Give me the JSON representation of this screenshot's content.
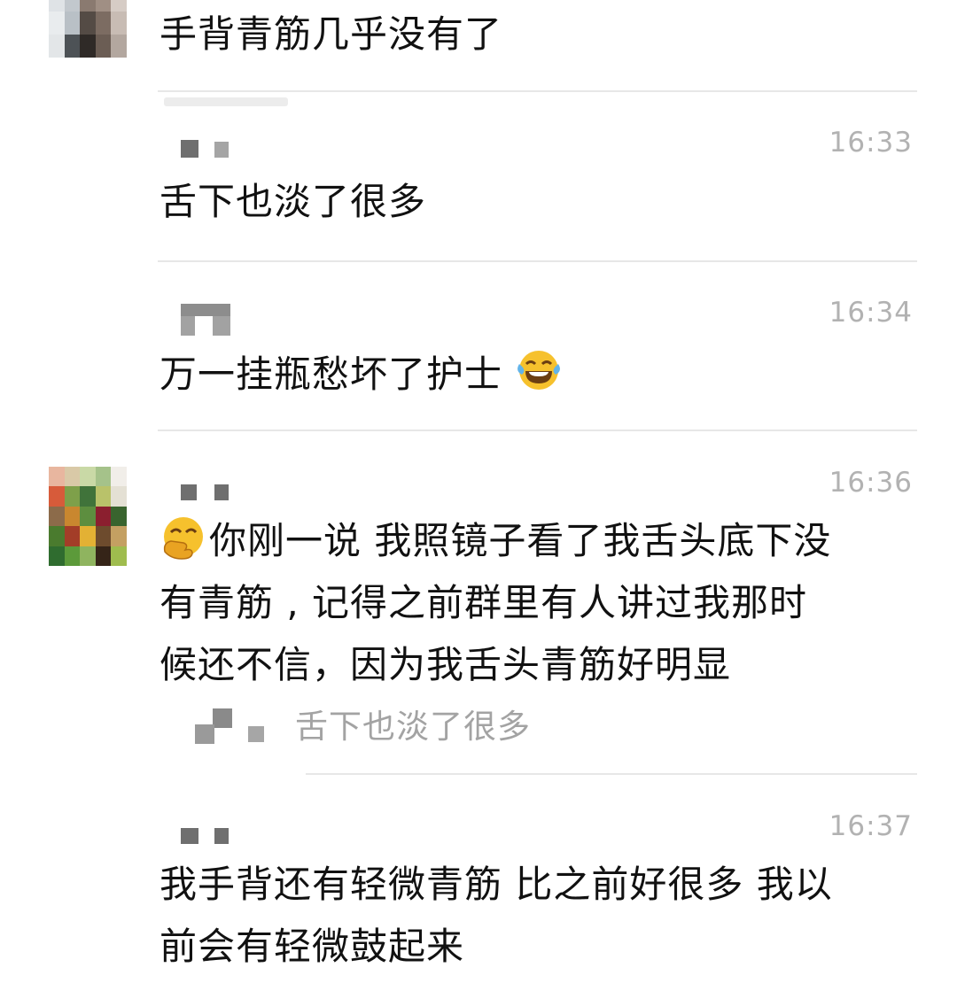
{
  "messages": [
    {
      "text": "手背青筋几乎没有了"
    },
    {
      "time": "16:33",
      "text": "舌下也淡了很多"
    },
    {
      "time": "16:34",
      "text": "万一挂瓶愁坏了护士",
      "emoji": "laughing-tears-emoji"
    },
    {
      "time": "16:36",
      "emoji": "hand-over-mouth-emoji",
      "lines": [
        "你刚一说 我照镜子看了我舌头底下没",
        "有青筋 , 记得之前群里有人讲过我那时",
        "候还不信，因为我舌头青筋好明显"
      ],
      "quote": "舌下也淡了很多"
    },
    {
      "time": "16:37",
      "lines": [
        "我手背还有轻微青筋 比之前好很多 我以",
        "前会有轻微鼓起来"
      ]
    }
  ],
  "colors": {
    "text": "#111111",
    "time": "#b2b2b2",
    "divider": "#e7e7e7",
    "quote": "#a3a3a3",
    "background": "#ffffff"
  }
}
